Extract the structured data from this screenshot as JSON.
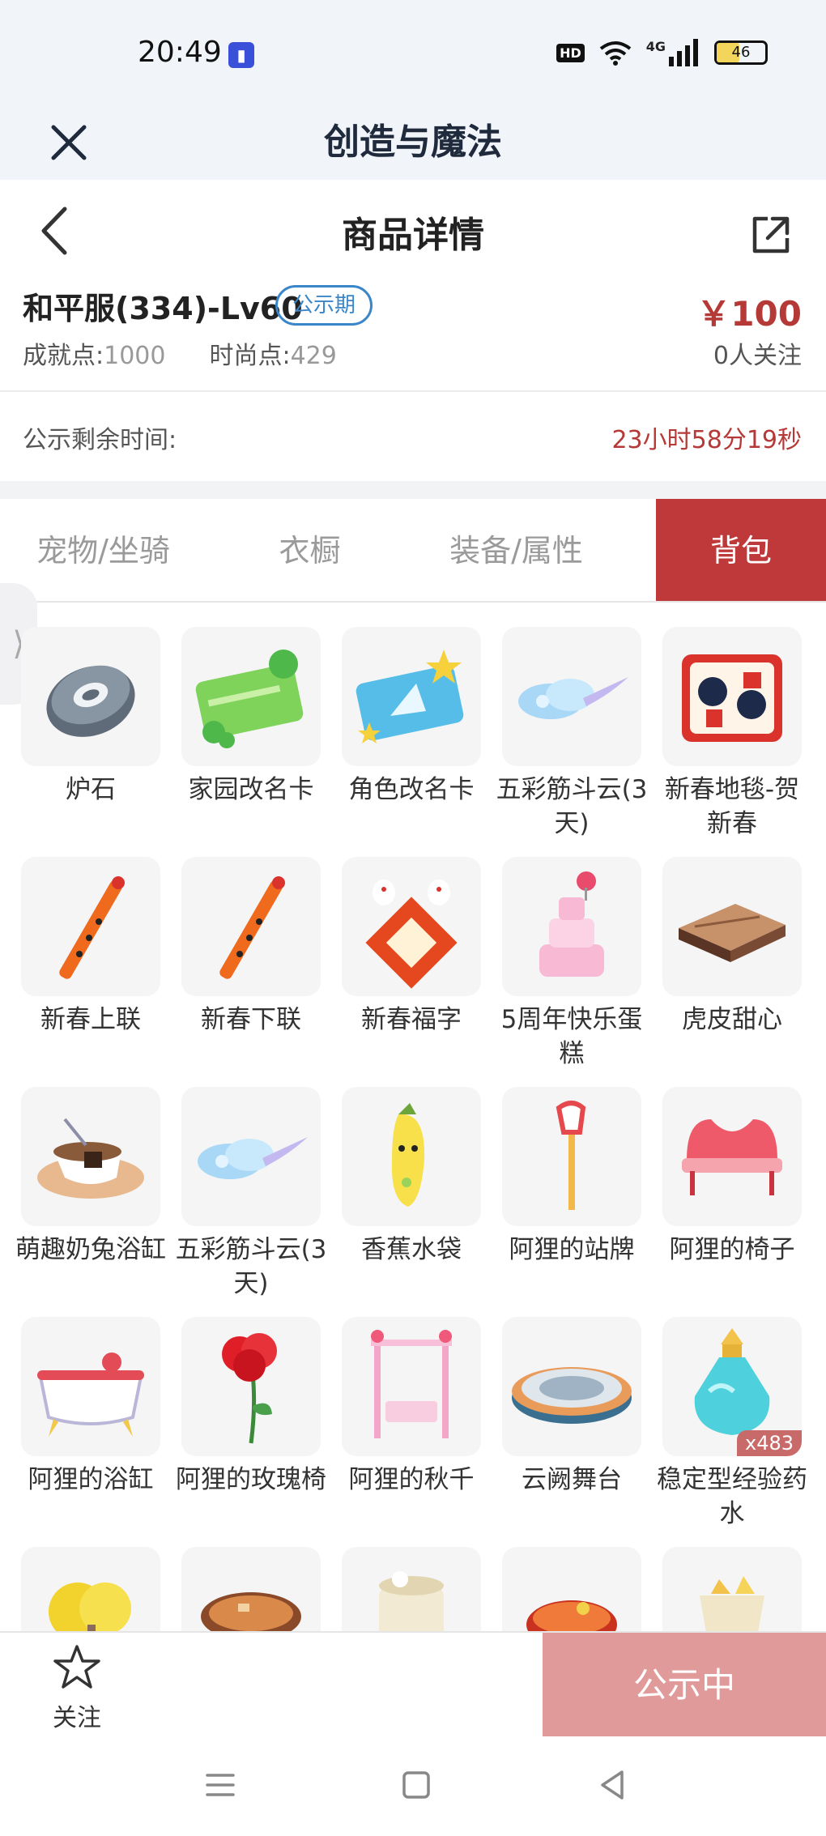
{
  "status_bar": {
    "time": "20:49",
    "hd": "HD",
    "network": "4G",
    "battery": "46"
  },
  "app": {
    "title": "创造与魔法"
  },
  "header": {
    "title": "商品详情"
  },
  "product": {
    "name": "和平服(334)-Lv60",
    "tag": "公示期",
    "price": "￥100",
    "achievement_label": "成就点:",
    "achievement_value": "1000",
    "fashion_label": "时尚点:",
    "fashion_value": "429",
    "followers": "0人关注"
  },
  "countdown": {
    "label": "公示剩余时间:",
    "value": "23小时58分19秒"
  },
  "tabs": [
    {
      "label": "宠物/坐骑",
      "active": false
    },
    {
      "label": "衣橱",
      "active": false
    },
    {
      "label": "装备/属性",
      "active": false
    },
    {
      "label": "背包",
      "active": true
    }
  ],
  "items": [
    {
      "label": "炉石",
      "icon": "hearthstone-icon"
    },
    {
      "label": "家园改名卡",
      "icon": "home-rename-card-icon"
    },
    {
      "label": "角色改名卡",
      "icon": "character-rename-card-icon"
    },
    {
      "label": "五彩筋斗云(3天)",
      "icon": "cloud-icon"
    },
    {
      "label": "新春地毯-贺新春",
      "icon": "carpet-icon"
    },
    {
      "label": "新春上联",
      "icon": "couplet-icon"
    },
    {
      "label": "新春下联",
      "icon": "couplet-icon"
    },
    {
      "label": "新春福字",
      "icon": "fu-character-icon"
    },
    {
      "label": "5周年快乐蛋糕",
      "icon": "cake-icon"
    },
    {
      "label": "虎皮甜心",
      "icon": "dessert-icon"
    },
    {
      "label": "萌趣奶兔浴缸",
      "icon": "teacup-bath-icon"
    },
    {
      "label": "五彩筋斗云(3天)",
      "icon": "cloud-icon"
    },
    {
      "label": "香蕉水袋",
      "icon": "banana-icon"
    },
    {
      "label": "阿狸的站牌",
      "icon": "sign-icon"
    },
    {
      "label": "阿狸的椅子",
      "icon": "chair-icon"
    },
    {
      "label": "阿狸的浴缸",
      "icon": "bathtub-icon"
    },
    {
      "label": "阿狸的玫瑰椅",
      "icon": "rose-icon"
    },
    {
      "label": "阿狸的秋千",
      "icon": "swing-icon"
    },
    {
      "label": "云阙舞台",
      "icon": "stage-icon"
    },
    {
      "label": "稳定型经验药水",
      "icon": "potion-icon",
      "qty": "x483"
    }
  ],
  "bottom_bar": {
    "follow_label": "关注",
    "notice_button": "公示中"
  },
  "colors": {
    "accent": "#c0393a",
    "price": "#b53a37",
    "tag": "#3a86c8",
    "notice_btn": "#e09a99"
  }
}
